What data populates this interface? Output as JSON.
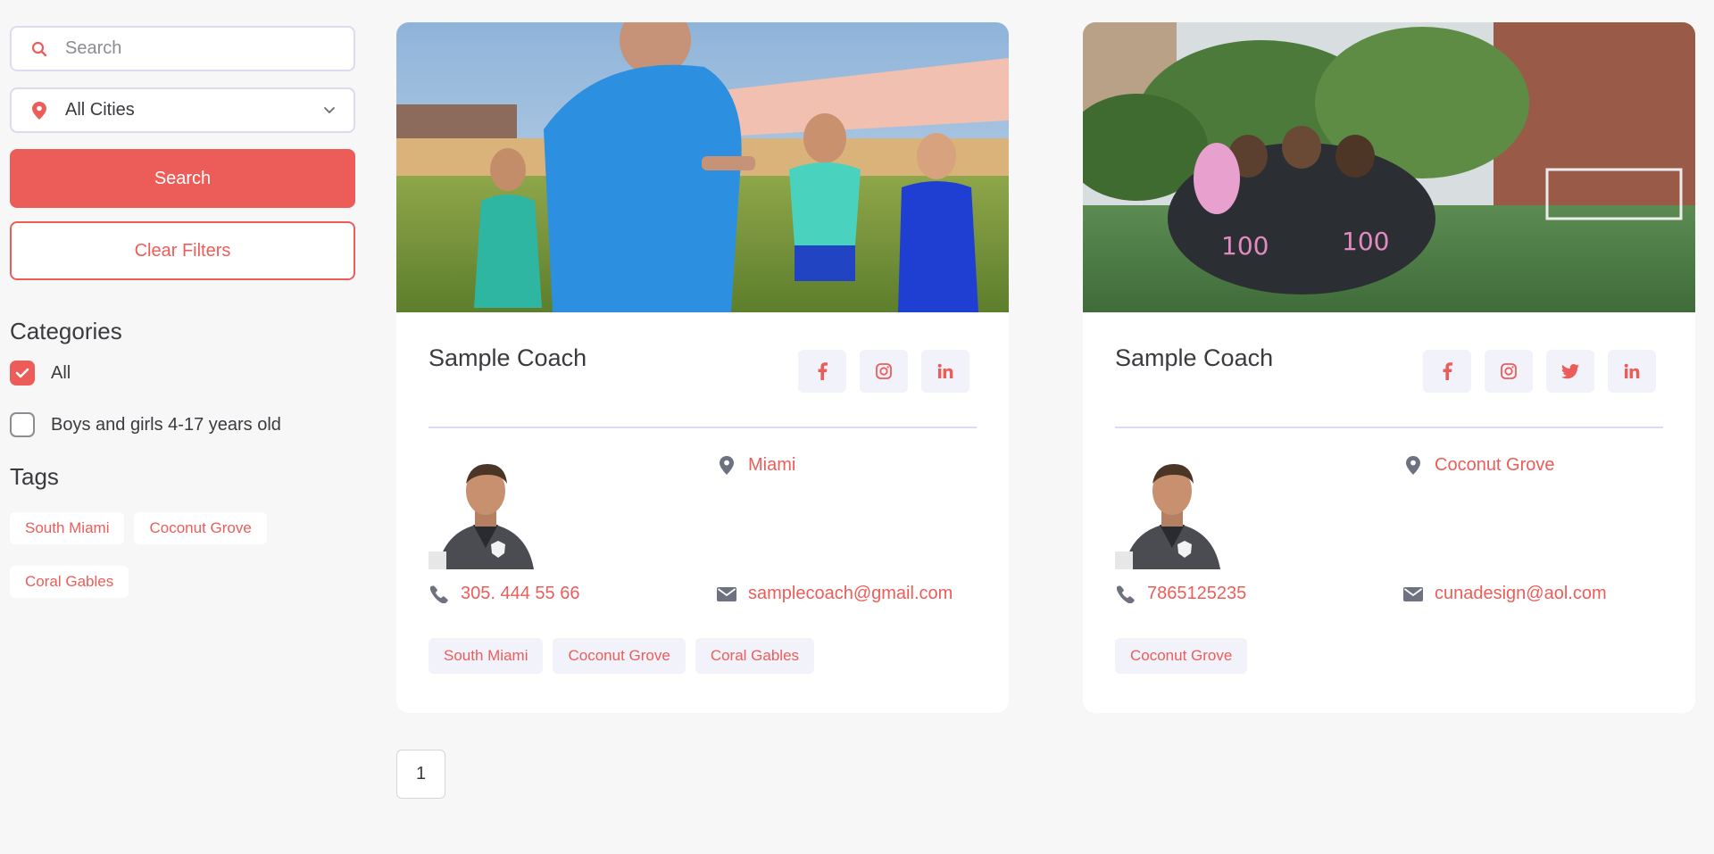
{
  "filters": {
    "search_placeholder": "Search",
    "city_value": "All Cities",
    "search_button": "Search",
    "clear_button": "Clear Filters"
  },
  "categories": {
    "heading": "Categories",
    "items": [
      {
        "label": "All",
        "checked": true
      },
      {
        "label": "Boys and girls 4-17 years old",
        "checked": false
      }
    ]
  },
  "tags": {
    "heading": "Tags",
    "items": [
      "South Miami",
      "Coconut Grove",
      "Coral Gables"
    ]
  },
  "coaches": [
    {
      "name": "Sample Coach",
      "socials": [
        "facebook-icon",
        "instagram-icon",
        "linkedin-icon"
      ],
      "location": "Miami",
      "phone": "305. 444 55 66",
      "email": "samplecoach@gmail.com",
      "tags": [
        "South Miami",
        "Coconut Grove",
        "Coral Gables"
      ]
    },
    {
      "name": "Sample Coach",
      "socials": [
        "facebook-icon",
        "instagram-icon",
        "twitter-icon",
        "linkedin-icon"
      ],
      "location": "Coconut Grove",
      "phone": "7865125235",
      "email": "cunadesign@aol.com",
      "tags": [
        "Coconut Grove"
      ]
    }
  ],
  "pagination": {
    "current": "1"
  },
  "colors": {
    "accent": "#ec5d59",
    "muted_bg": "#f2f2fb",
    "border": "#dcdcf0"
  }
}
